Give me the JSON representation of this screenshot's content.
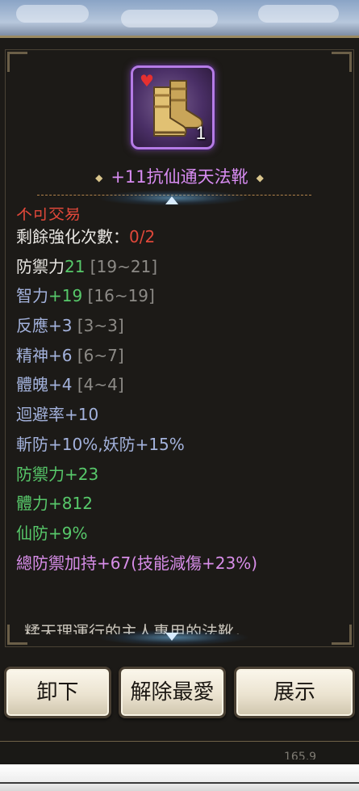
{
  "item": {
    "count": "1",
    "name": "+11抗仙通天法靴"
  },
  "stats": {
    "cutoff_top": "不可交易",
    "enhance_label": "剩餘強化次數：",
    "enhance_value": "0/2",
    "lines": [
      {
        "label": "防禦力",
        "value": "21",
        "range": " [19~21]"
      },
      {
        "label": "智力",
        "value": "+19",
        "range": " [16~19]"
      },
      {
        "label": "反應",
        "value": "+3",
        "range": " [3~3]"
      },
      {
        "label": "精神",
        "value": "+6",
        "range": " [6~7]"
      },
      {
        "label": "體魄",
        "value": "+4",
        "range": " [4~4]"
      }
    ],
    "extra_blue": [
      "迴避率+10",
      "斬防+10%,妖防+15%"
    ],
    "extra_green": [
      "防禦力+23",
      "體力+812",
      "仙防+9%"
    ],
    "set_bonus": "總防禦加持+67(技能減傷+23%)"
  },
  "description_cutoff": "糅天理運行的主人專用的法靴，",
  "buttons": {
    "unequip": "卸下",
    "unfavorite": "解除最愛",
    "show": "展示"
  },
  "background_number": "165,9",
  "colors": {
    "item_name": "#d88cf2",
    "enhance_value": "#e0483a",
    "bonus_green": "#57c86a",
    "attribute_blue": "#a3b2dc",
    "set_purple": "#d78de8",
    "rarity_border": "#b57be6"
  },
  "icons": {
    "favorite": "heart-icon",
    "item": "boots-icon",
    "scroll_up": "scroll-up-icon",
    "scroll_down": "scroll-down-icon"
  }
}
